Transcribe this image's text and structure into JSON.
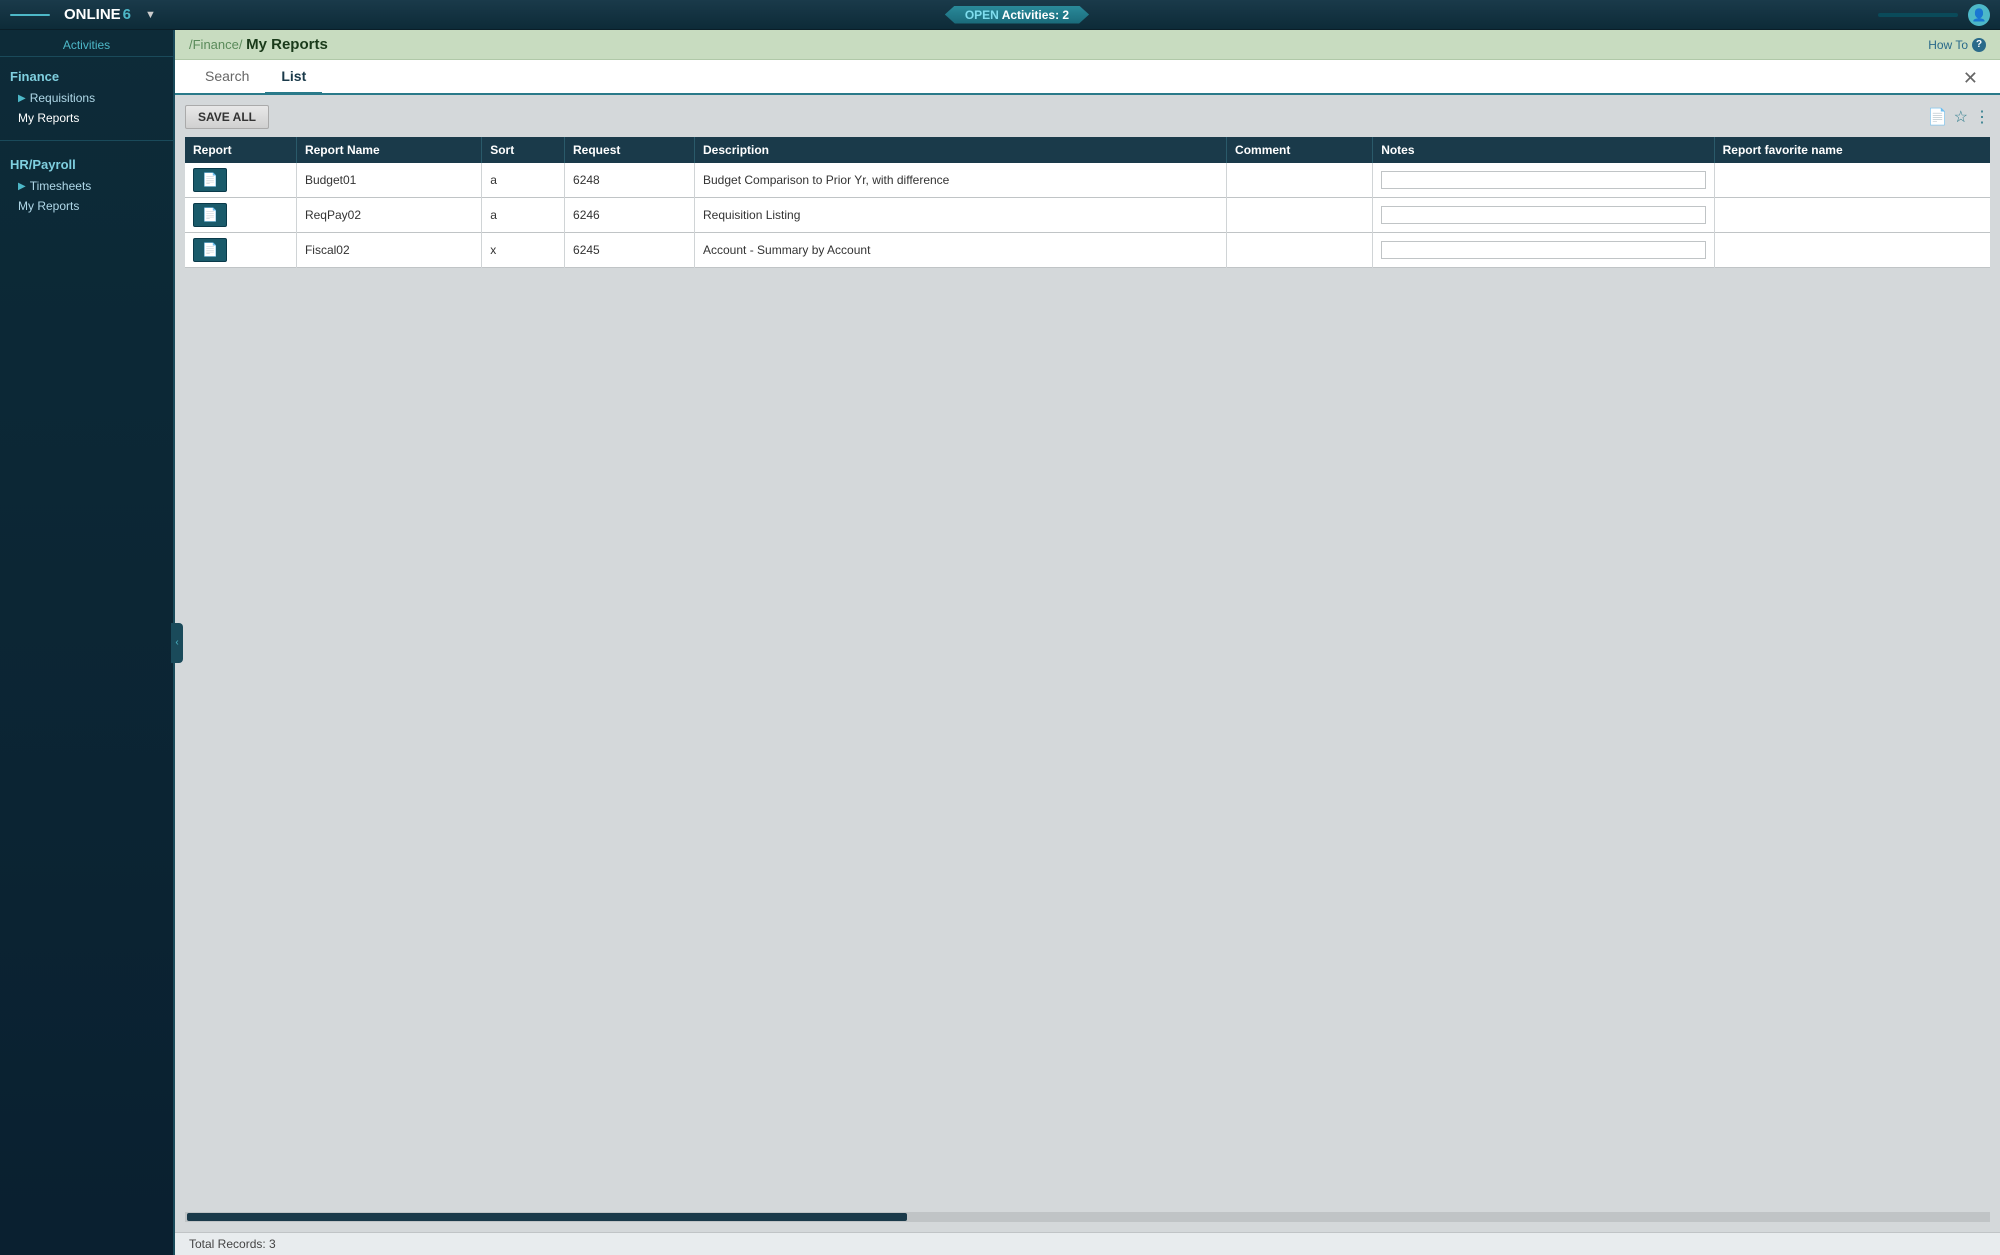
{
  "topbar": {
    "logo": "ONLINE",
    "logo_num": "6",
    "dropdown_label": "▼",
    "activities_label": "OPEN Activities: 2",
    "user_icon": "👤"
  },
  "sidebar": {
    "activities_label": "Activities",
    "sections": [
      {
        "category": "Finance",
        "items": [
          {
            "label": "Requisitions",
            "arrow": "▶",
            "active": false
          },
          {
            "label": "My Reports",
            "active": true
          }
        ]
      },
      {
        "category": "HR/Payroll",
        "items": [
          {
            "label": "Timesheets",
            "arrow": "▶",
            "active": false
          },
          {
            "label": "My Reports",
            "active": false
          }
        ]
      }
    ],
    "collapse_icon": "‹"
  },
  "breadcrumb": {
    "path": "/Finance/",
    "current": "My Reports"
  },
  "how_to": "How To",
  "tabs": [
    {
      "label": "Search",
      "active": false
    },
    {
      "label": "List",
      "active": true
    }
  ],
  "close_btn": "✕",
  "toolbar": {
    "save_all_label": "SAVE ALL"
  },
  "toolbar_icons": {
    "document_icon": "📄",
    "star_icon": "☆",
    "columns_icon": "⋮"
  },
  "table": {
    "headers": [
      "Report",
      "Report Name",
      "Sort",
      "Request",
      "Description",
      "Comment",
      "Notes",
      "Report favorite name"
    ],
    "rows": [
      {
        "report_btn": "📄",
        "report_name": "Budget01",
        "sort": "a",
        "request": "6248",
        "description": "Budget Comparison to Prior Yr, with difference",
        "comment": "",
        "notes": "",
        "favorite_name": ""
      },
      {
        "report_btn": "📄",
        "report_name": "ReqPay02",
        "sort": "a",
        "request": "6246",
        "description": "Requisition Listing",
        "comment": "",
        "notes": "",
        "favorite_name": ""
      },
      {
        "report_btn": "📄",
        "report_name": "Fiscal02",
        "sort": "x",
        "request": "6245",
        "description": "Account - Summary by Account",
        "comment": "",
        "notes": "",
        "favorite_name": ""
      }
    ]
  },
  "footer": {
    "total_records_label": "Total Records: 3"
  }
}
